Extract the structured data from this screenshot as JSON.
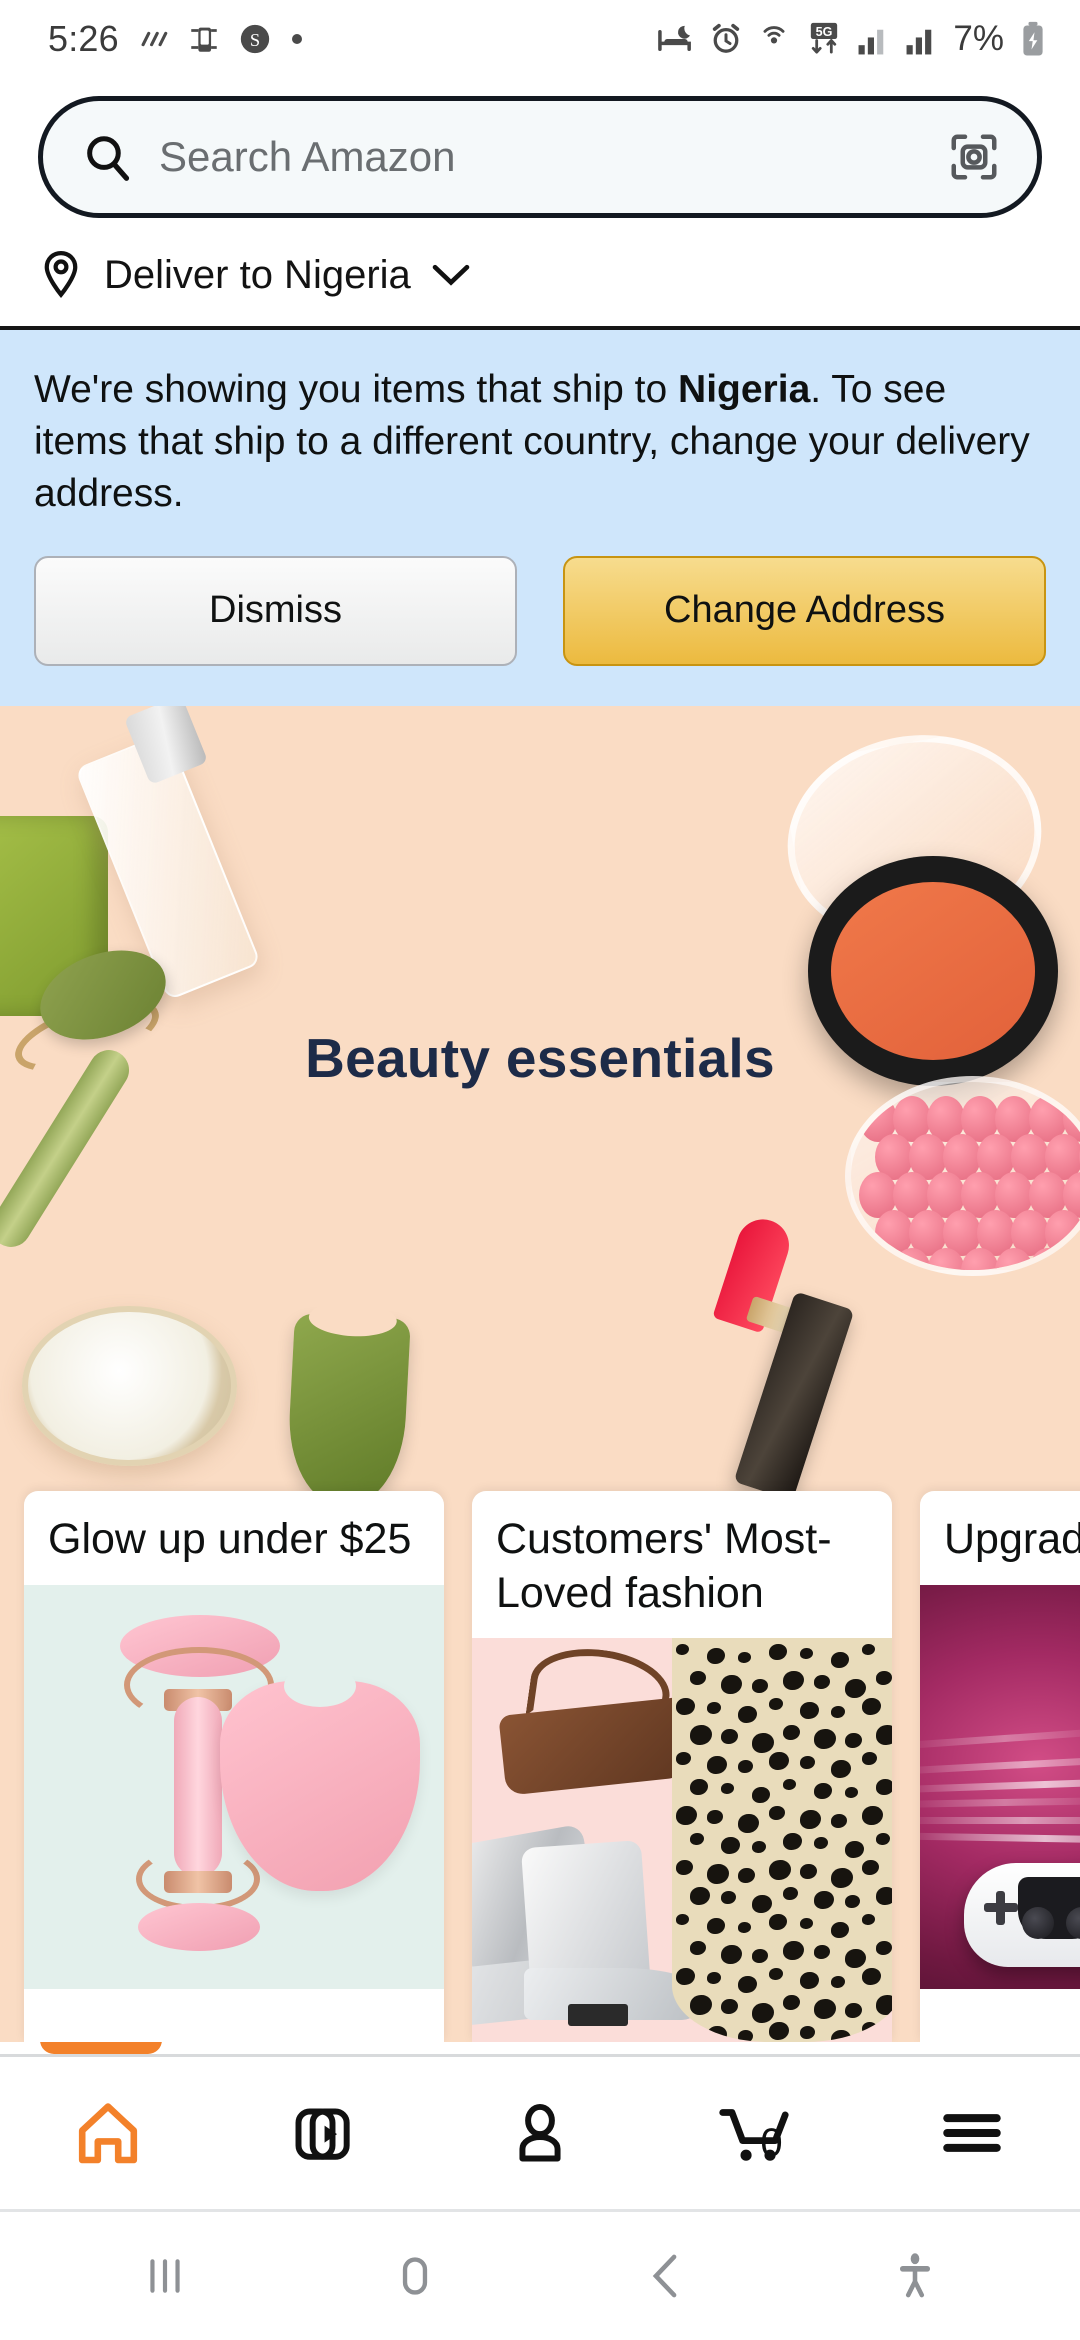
{
  "status_bar": {
    "time": "5:26",
    "battery_percent": "7%",
    "left_icons": [
      "weather-rain-icon",
      "device-phone-icon",
      "samsung-s-icon",
      "dot-icon"
    ],
    "right_icons": [
      "bedtime-icon",
      "alarm-icon",
      "hotspot-icon",
      "network-5g-icon",
      "signal-bars-sim1-icon",
      "signal-bars-sim2-icon",
      "battery-charging-icon"
    ],
    "network_label": "5G"
  },
  "search": {
    "placeholder": "Search Amazon",
    "value": "",
    "search_icon": "search-icon",
    "camera_icon": "camera-scan-icon"
  },
  "deliver": {
    "label": "Deliver to Nigeria",
    "pin_icon": "location-pin-icon",
    "chevron_icon": "chevron-down-icon"
  },
  "banner": {
    "text_before": "We're showing you items that ship to ",
    "country": "Nigeria",
    "text_after": ". To see items that ship to a different country, change your delivery address.",
    "dismiss_label": "Dismiss",
    "change_label": "Change Address",
    "background_color": "#cfe6fb",
    "change_button_color": "#ecba3f"
  },
  "hero": {
    "title": "Beauty essentials",
    "title_color": "#1d2b48",
    "background_color": "#fadcc4"
  },
  "cards": [
    {
      "title": "Glow up under $25",
      "media_background": "#e3f0ec",
      "media_name": "rose-quartz-roller-guasha-image"
    },
    {
      "title": "Customers' Most-Loved fashion",
      "media_background": "#fbddd9",
      "media_name": "fashion-bag-boots-skirt-image"
    },
    {
      "title": "Upgrade gaming g",
      "media_background": "#a32a63",
      "media_name": "gaming-pc-controller-image"
    }
  ],
  "bottom_nav": {
    "active_color": "#f3812a",
    "cart_count": "0",
    "items": [
      {
        "name": "home",
        "icon": "home-icon",
        "active": true
      },
      {
        "name": "video",
        "icon": "video-stack-icon",
        "active": false
      },
      {
        "name": "account",
        "icon": "person-icon",
        "active": false
      },
      {
        "name": "cart",
        "icon": "shopping-cart-icon",
        "active": false
      },
      {
        "name": "menu",
        "icon": "hamburger-menu-icon",
        "active": false
      }
    ]
  },
  "system_nav": {
    "items": [
      {
        "name": "recents",
        "icon": "recents-bars-icon"
      },
      {
        "name": "home",
        "icon": "home-pill-icon"
      },
      {
        "name": "back",
        "icon": "back-chevron-icon"
      },
      {
        "name": "accessibility",
        "icon": "accessibility-person-icon"
      }
    ]
  }
}
